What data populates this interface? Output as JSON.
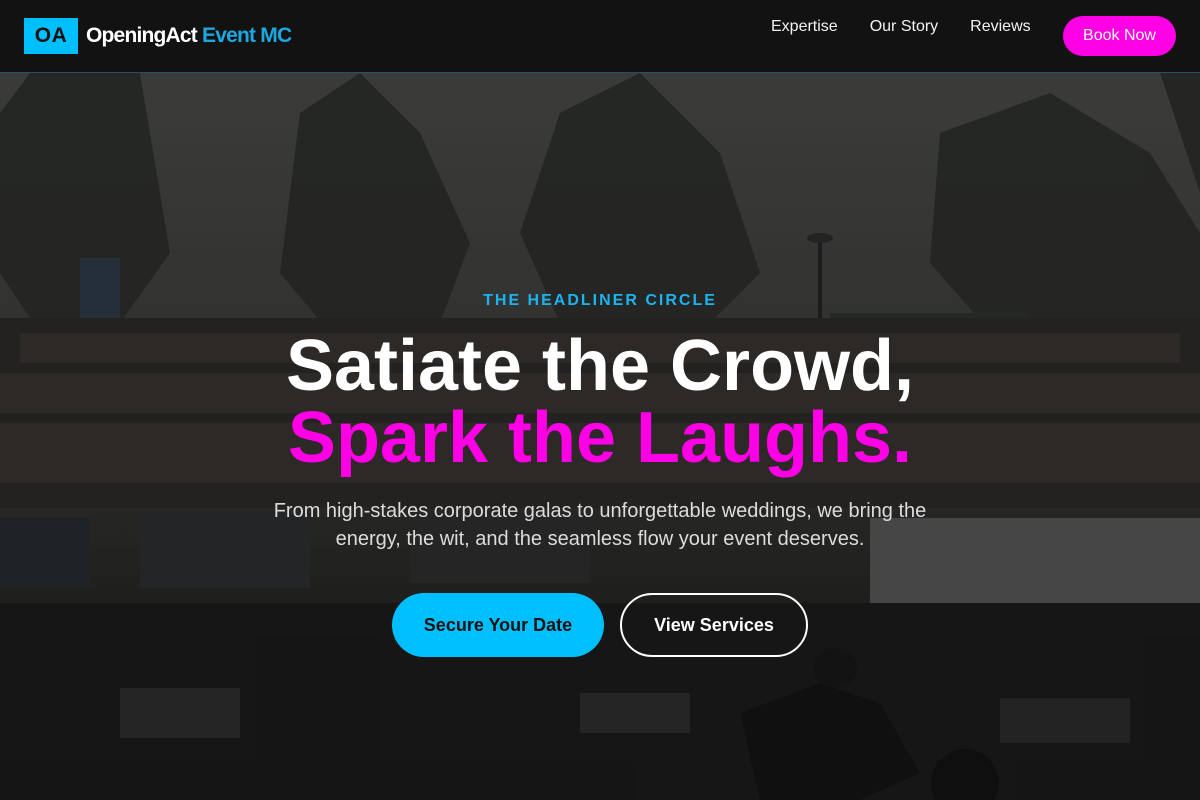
{
  "brand": {
    "logo_initials": "OA",
    "name": "OpeningAct",
    "accent_text": "Event MC",
    "accent_color": "#00bfff"
  },
  "nav": {
    "items": [
      {
        "label": "Expertise"
      },
      {
        "label": "Our Story"
      },
      {
        "label": "Reviews"
      }
    ],
    "cta_label": "Book Now",
    "cta_color": "#ff00e6"
  },
  "hero": {
    "eyebrow": "THE HEADLINER CIRCLE",
    "title_line1": "Satiate the Crowd,",
    "title_line2": "Spark the Laughs.",
    "subtitle": "From high-stakes corporate galas to unforgettable weddings, we bring the energy, the wit, and the seamless flow your event deserves.",
    "primary_button": "Secure Your Date",
    "secondary_button": "View Services",
    "background": "dim crowd-at-outdoor-event photo"
  }
}
